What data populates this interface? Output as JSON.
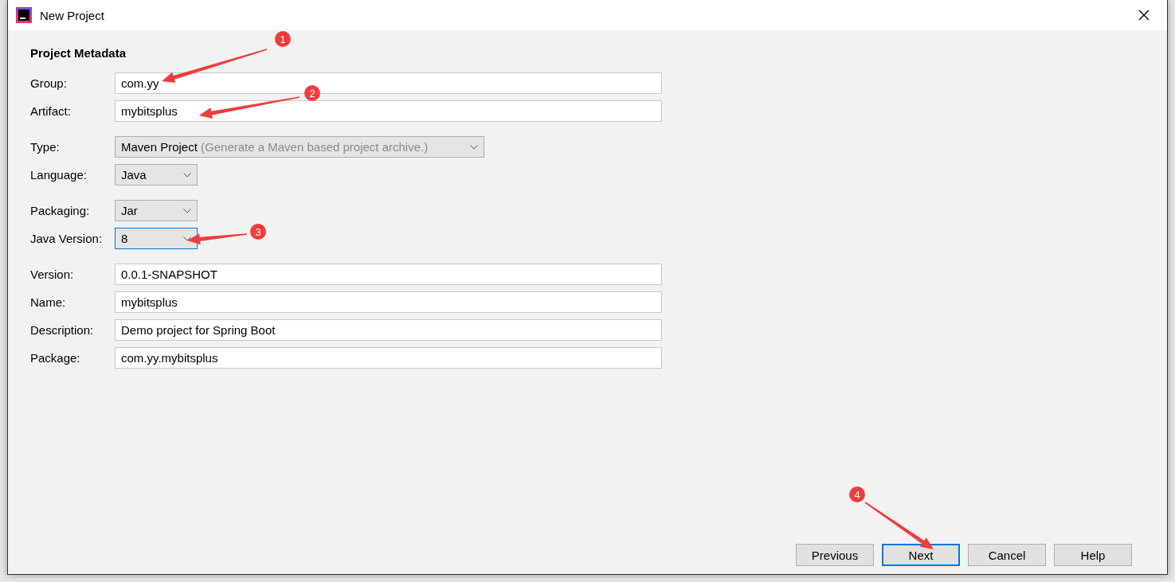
{
  "window": {
    "title": "New Project"
  },
  "section_title": "Project Metadata",
  "groups": [
    [
      {
        "label": "Group:",
        "kind": "text",
        "value": "com.yy"
      },
      {
        "label": "Artifact:",
        "kind": "text",
        "value": "mybitsplus"
      }
    ],
    [
      {
        "label": "Type:",
        "kind": "dropdown",
        "value": "Maven Project",
        "hint": "(Generate a Maven based project archive.)",
        "focused": false
      },
      {
        "label": "Language:",
        "kind": "dropdown",
        "value": "Java",
        "focused": false
      }
    ],
    [
      {
        "label": "Packaging:",
        "kind": "dropdown",
        "value": "Jar",
        "focused": false
      },
      {
        "label": "Java Version:",
        "kind": "dropdown",
        "value": "8",
        "focused": true
      }
    ],
    [
      {
        "label": "Version:",
        "kind": "text",
        "value": "0.0.1-SNAPSHOT"
      },
      {
        "label": "Name:",
        "kind": "text",
        "value": "mybitsplus"
      },
      {
        "label": "Description:",
        "kind": "text",
        "value": "Demo project for Spring Boot"
      },
      {
        "label": "Package:",
        "kind": "text",
        "value": "com.yy.mybitsplus"
      }
    ]
  ],
  "buttons": [
    {
      "label": "Previous",
      "focused": false
    },
    {
      "label": "Next",
      "focused": true
    },
    {
      "label": "Cancel",
      "focused": false
    },
    {
      "label": "Help",
      "focused": false
    }
  ],
  "annotations": [
    {
      "label": "1"
    },
    {
      "label": "2"
    },
    {
      "label": "3"
    },
    {
      "label": "4"
    }
  ]
}
